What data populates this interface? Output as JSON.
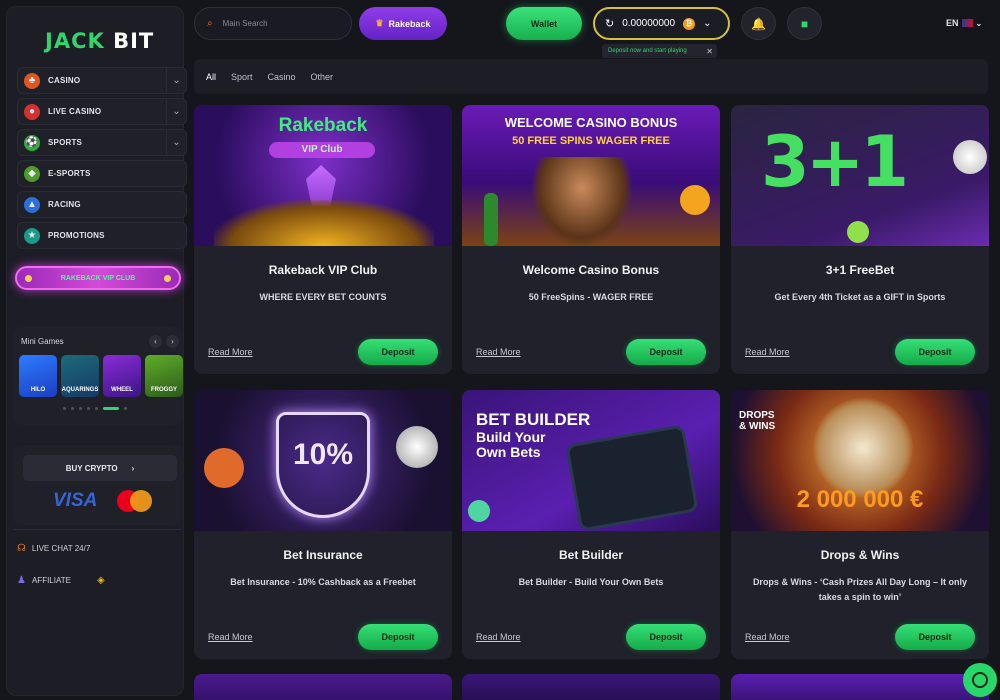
{
  "brand": {
    "logo_left": "JACK",
    "logo_right": "BIT"
  },
  "sidebar": {
    "items": [
      {
        "label": "CASINO",
        "icon": "casino-icon",
        "has_chevron": true
      },
      {
        "label": "LIVE CASINO",
        "icon": "live-casino-icon",
        "has_chevron": true
      },
      {
        "label": "SPORTS",
        "icon": "sports-icon",
        "has_chevron": true
      },
      {
        "label": "E-SPORTS",
        "icon": "esports-icon",
        "has_chevron": false
      },
      {
        "label": "RACING",
        "icon": "racing-icon",
        "has_chevron": false
      },
      {
        "label": "PROMOTIONS",
        "icon": "promotions-icon",
        "has_chevron": false
      }
    ],
    "vip_label": "RAKEBACK VIP CLUB",
    "mini_games": {
      "title": "Mini Games",
      "games": [
        "HILO",
        "AQUARINGS",
        "WHEEL",
        "FROGGY"
      ]
    },
    "buy_crypto_label": "BUY CRYPTO",
    "payment": {
      "visa": "VISA"
    },
    "live_chat_label": "LIVE CHAT 24/7",
    "affiliate_label": "AFFILIATE"
  },
  "header": {
    "search_placeholder": "Main Search",
    "rakeback_label": "Rakeback",
    "wallet_label": "Wallet",
    "balance": "0.00000000",
    "deposit_tooltip": "Deposit now and start playing",
    "language": "EN"
  },
  "filters": {
    "items": [
      "All",
      "Sport",
      "Casino",
      "Other"
    ],
    "active": "All"
  },
  "promos": [
    {
      "title": "Rakeback VIP Club",
      "subtitle": "WHERE EVERY BET COUNTS",
      "read_more": "Read More",
      "cta": "Deposit",
      "banner_line1": "Rakeback",
      "banner_line2": "VIP Club"
    },
    {
      "title": "Welcome Casino Bonus",
      "subtitle": "50 FreeSpins - WAGER FREE",
      "read_more": "Read More",
      "cta": "Deposit",
      "banner_line1": "WELCOME CASINO BONUS",
      "banner_line2": "50 FREE SPINS WAGER FREE"
    },
    {
      "title": "3+1 FreeBet",
      "subtitle": "Get Every 4th Ticket as a GIFT in Sports",
      "read_more": "Read More",
      "cta": "Deposit",
      "banner_line1": "3+1"
    },
    {
      "title": "Bet Insurance",
      "subtitle": "Bet Insurance - 10% Cashback as a Freebet",
      "read_more": "Read More",
      "cta": "Deposit",
      "banner_line1": "10%"
    },
    {
      "title": "Bet Builder",
      "subtitle": "Bet Builder - Build Your Own Bets",
      "read_more": "Read More",
      "cta": "Deposit",
      "banner_line1": "BET BUILDER",
      "banner_line2": "Build Your Own Bets"
    },
    {
      "title": "Drops & Wins",
      "subtitle": "Drops & Wins - ‘Cash Prizes All Day Long – It only takes a spin to win’",
      "read_more": "Read More",
      "cta": "Deposit",
      "banner_line1": "DROPS & WINS",
      "banner_line2": "2 000 000 €"
    }
  ],
  "colors": {
    "accent_green": "#2fd66b",
    "purple": "#7b2fd8",
    "bg": "#15161c",
    "card": "#20212a"
  }
}
